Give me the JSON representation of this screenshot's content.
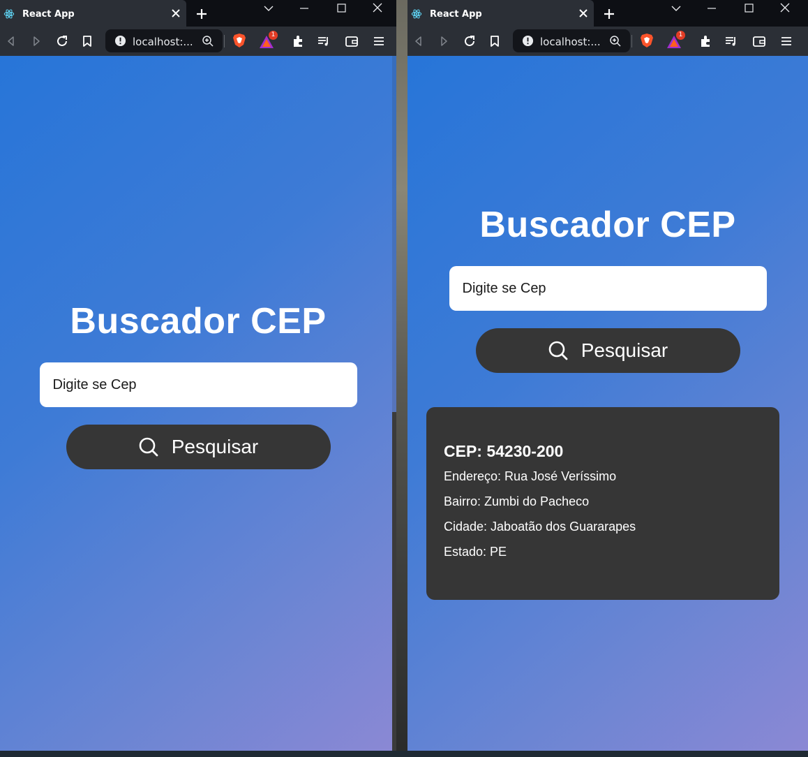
{
  "browser": {
    "tab_title": "React App",
    "url": "localhost:...",
    "rewards_badge": "1"
  },
  "app": {
    "title": "Buscador CEP",
    "input_placeholder": "Digite se Cep",
    "search_label": "Pesquisar"
  },
  "result": {
    "cep": "CEP: 54230-200",
    "endereco": "Endereço: Rua José Veríssimo",
    "bairro": "Bairro: Zumbi do Pacheco",
    "cidade": "Cidade: Jaboatão dos Guararapes",
    "estado": "Estado: PE"
  },
  "colors": {
    "accent_dark": "#363636",
    "gradient_start": "#2775d8",
    "gradient_end": "#8b88d4"
  }
}
